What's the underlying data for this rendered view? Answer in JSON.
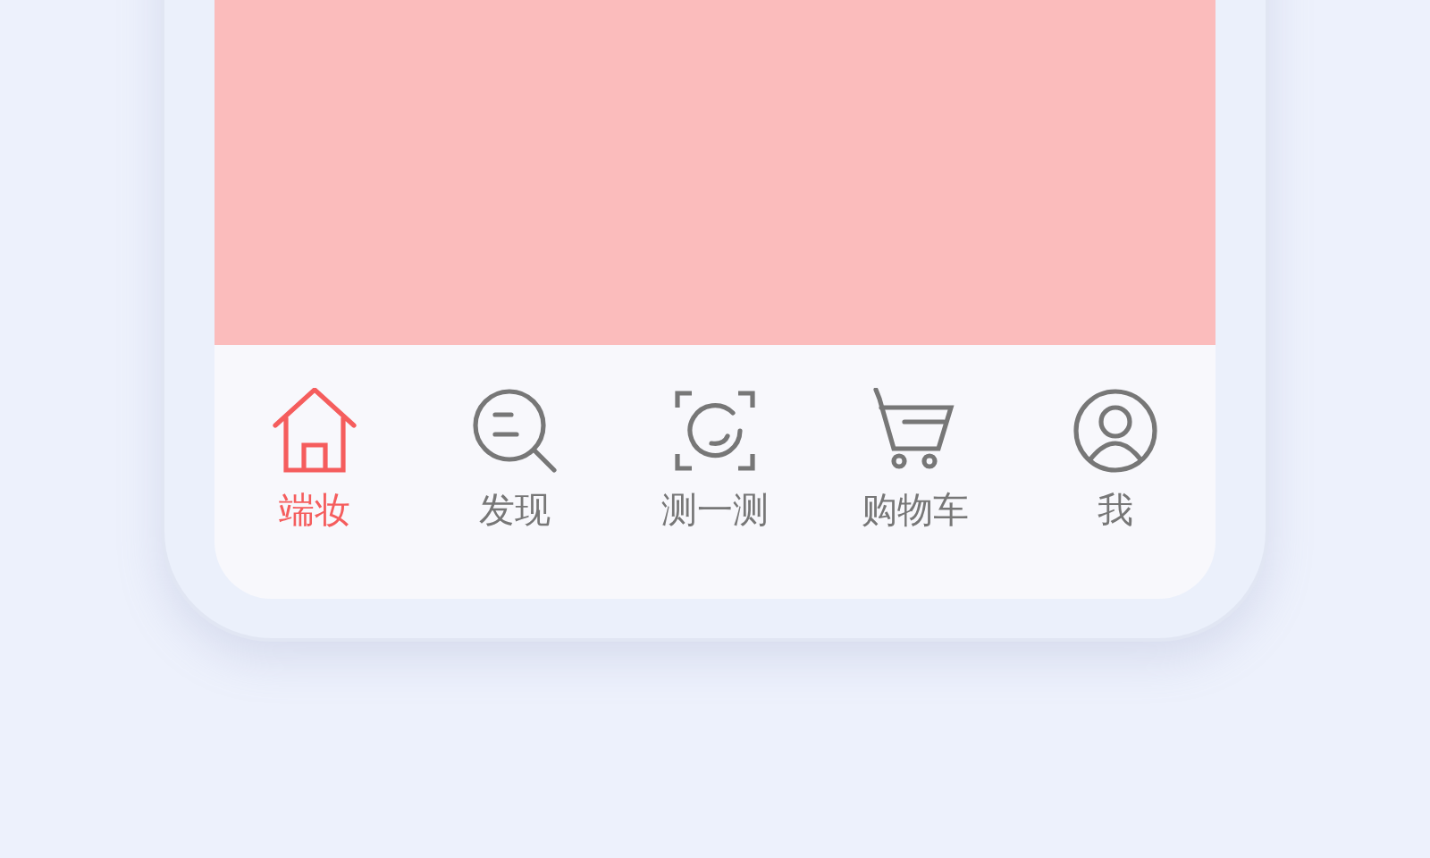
{
  "tab_bar": {
    "tabs": [
      {
        "label": "端妆",
        "kind": "home",
        "selected": true
      },
      {
        "label": "发现",
        "kind": "discover",
        "selected": false
      },
      {
        "label": "测一测",
        "kind": "scan",
        "selected": false
      },
      {
        "label": "购物车",
        "kind": "cart",
        "selected": false
      },
      {
        "label": "我",
        "kind": "user",
        "selected": false
      }
    ]
  }
}
